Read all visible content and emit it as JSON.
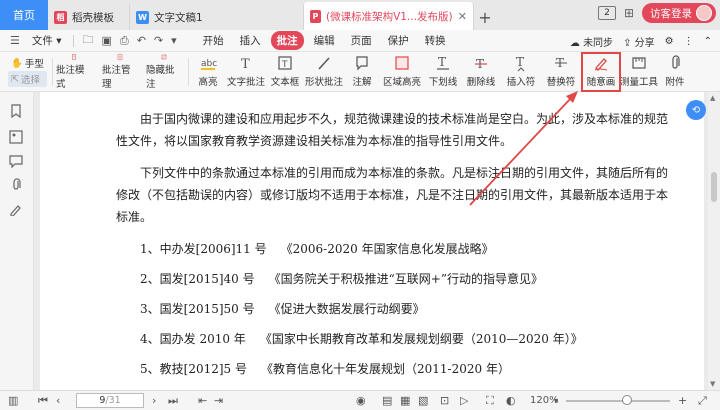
{
  "tabs": {
    "home": "首页",
    "items": [
      {
        "label": "稻壳模板",
        "icon": "docer-icon",
        "color": "#e3475a"
      },
      {
        "label": "文字文稿1",
        "icon": "word-doc-icon",
        "color": "#3d8ef7"
      },
      {
        "label": "(微课标准架构V1...发布版) .pdf",
        "icon": "pdf-icon",
        "color": "#e3475a"
      }
    ],
    "add": "+",
    "page_count": "2",
    "login": "访客登录"
  },
  "menu": {
    "file": "文件",
    "items": [
      "开始",
      "插入",
      "批注",
      "编辑",
      "页面",
      "保护",
      "转换"
    ],
    "active": "批注",
    "sync": "未同步",
    "share": "分享"
  },
  "ribbon": {
    "hand": "手型",
    "select": "选择",
    "buttons": [
      "批注模式",
      "批注管理",
      "隐藏批注",
      "高亮",
      "文字批注",
      "文本框",
      "形状批注",
      "注解",
      "区域高亮",
      "下划线",
      "删除线",
      "插入符",
      "替换符",
      "随意画",
      "测量工具",
      "附件"
    ],
    "accent": "#e04848"
  },
  "document": {
    "para1": "由于国内微课的建设和应用起步不久，规范微课建设的技术标准尚是空白。为此，涉及本标准的规范性文件，将以国家教育教学资源建设相关标准为本标准的指导性引用文件。",
    "para2": "下列文件中的条款通过本标准的引用而成为本标准的条款。凡是标注日期的引用文件，其随后所有的修改（不包括勘误的内容）或修订版均不适用于本标准，凡是不注日期的引用文件，其最新版本适用于本标准。",
    "list": [
      {
        "num": "1、中办发[2006]11 号",
        "title": "《2006-2020 年国家信息化发展战略》"
      },
      {
        "num": "2、国发[2015]40 号",
        "title": "《国务院关于积极推进“互联网+”行动的指导意见》"
      },
      {
        "num": "3、国发[2015]50 号",
        "title": "《促进大数据发展行动纲要》"
      },
      {
        "num": "4、国办发 2010 年",
        "title": "《国家中长期教育改革和发展规划纲要（2010—2020 年）》"
      },
      {
        "num": "5、教技[2012]5 号",
        "title": "《教育信息化十年发展规划（2011-2020 年）"
      }
    ]
  },
  "status": {
    "page_current": "9",
    "page_total": "/31",
    "zoom": "120%"
  }
}
